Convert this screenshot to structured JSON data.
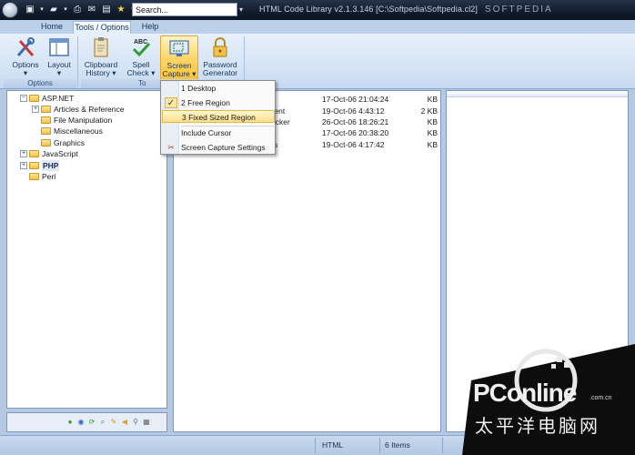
{
  "window": {
    "title": "HTML Code Library v2.1.3.146 [C:\\Softpedia\\Softpedia.cl2]",
    "watermark": "SOFTPEDIA",
    "search_value": "Search..."
  },
  "tabs": [
    {
      "label": "Home"
    },
    {
      "label": "Tools / Options"
    },
    {
      "label": "Help"
    }
  ],
  "ribbon": {
    "options_label": "Options",
    "layout_label": "Layout",
    "clipboard_line1": "Clipboard",
    "clipboard_line2": "History",
    "spell_line1": "Spell",
    "spell_line2": "Check",
    "capture_line1": "Screen",
    "capture_line2": "Capture",
    "password_line1": "Password",
    "password_line2": "Generator",
    "group_options": "Options",
    "group_tools_partial": "To"
  },
  "tree": [
    {
      "label": "ASP.NET",
      "level": 0,
      "expander": "−"
    },
    {
      "label": "Articles & Reference",
      "level": 1,
      "expander": "+"
    },
    {
      "label": "File Manipulation",
      "level": 1,
      "expander": ""
    },
    {
      "label": "Miscellaneous",
      "level": 1,
      "expander": ""
    },
    {
      "label": "Graphics",
      "level": 1,
      "expander": ""
    },
    {
      "label": "JavaScript",
      "level": 0,
      "expander": "+"
    },
    {
      "label": "PHP",
      "level": 0,
      "expander": "+"
    },
    {
      "label": "Perl",
      "level": 0,
      "expander": ""
    }
  ],
  "list": [
    {
      "name": "",
      "date": "17-Oct-06 21:04:24",
      "size": "KB"
    },
    {
      "name": "tent",
      "date": "19-Oct-06 4:43:12",
      "size": "2 KB"
    },
    {
      "name": "ecker",
      "date": "26-Oct-06 18:26:21",
      "size": "KB"
    },
    {
      "name": "",
      "date": "17-Oct-06 20:38:20",
      "size": "KB"
    },
    {
      "name": "s",
      "date": "19-Oct-06 4:17:42",
      "size": "KB"
    }
  ],
  "menu": {
    "items": [
      {
        "label": "1 Desktop"
      },
      {
        "label": "2 Free Region"
      },
      {
        "label": "3 Fixed Sized Region"
      },
      {
        "label": "Include Cursor"
      },
      {
        "label": "Screen Capture Settings"
      }
    ]
  },
  "status": {
    "mode": "HTML",
    "count": "6 Items"
  },
  "logo": {
    "brand": "PConline",
    "domain": ".com.cn",
    "subtitle": "太平洋电脑网"
  },
  "colors": {
    "accent": "#ffd56a",
    "frame": "#b6c9e2",
    "titlebar": "#111b2b"
  }
}
